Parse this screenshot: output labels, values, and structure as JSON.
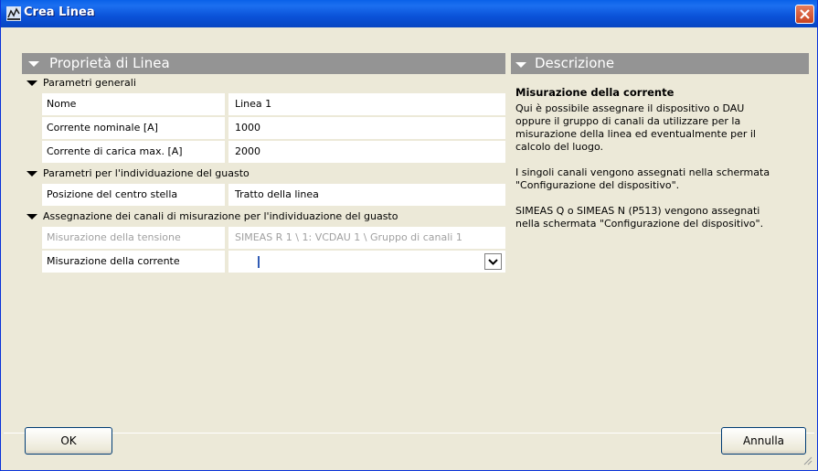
{
  "window": {
    "title": "Crea Linea",
    "icon": "app-network-icon",
    "close_icon": "close-icon"
  },
  "properties": {
    "header": "Proprietà di Linea",
    "categories": [
      {
        "label": "Parametri generali",
        "rows": [
          {
            "label": "Nome",
            "value": "Linea 1"
          },
          {
            "label": "Corrente nominale [A]",
            "value": "1000"
          },
          {
            "label": "Corrente di carica max. [A]",
            "value": "2000"
          }
        ]
      },
      {
        "label": "Parametri per l'individuazione del guasto",
        "rows": [
          {
            "label": "Posizione del centro stella",
            "value": "Tratto della linea"
          }
        ]
      },
      {
        "label": "Assegnazione dei canali di misurazione per l'individuazione del guasto",
        "rows": [
          {
            "label": "Misurazione della tensione",
            "value": "SIMEAS R 1 \\ 1: VCDAU 1 \\ Gruppo di canali 1"
          },
          {
            "label": "Misurazione della corrente",
            "value": ""
          }
        ]
      }
    ]
  },
  "description": {
    "header": "Descrizione",
    "title": "Misurazione della corrente",
    "paragraphs": [
      "Qui è possibile assegnare il dispositivo o DAU\noppure il gruppo di canali da utilizzare per la\nmisurazione della linea ed eventualmente per il\ncalcolo del luogo.",
      "I singoli canali vengono assegnati nella schermata\n\"Configurazione del dispositivo\".",
      "SIMEAS Q o SIMEAS N (P513) vengono assegnati\nnella schermata \"Configurazione del dispositivo\"."
    ]
  },
  "buttons": {
    "ok": "OK",
    "cancel": "Annulla"
  },
  "colors": {
    "titlebar": "#0a52d8",
    "panel_header": "#949494",
    "window_bg": "#ece9d8"
  }
}
